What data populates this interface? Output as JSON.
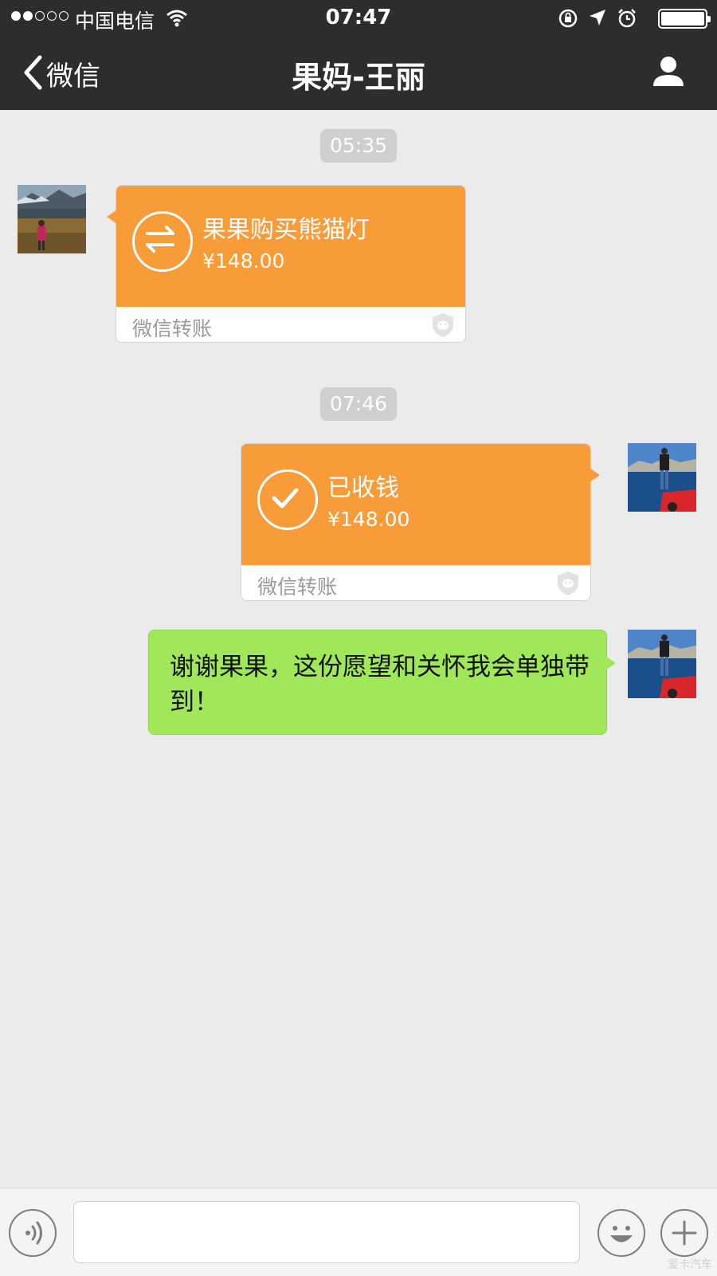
{
  "status_bar": {
    "carrier": "中国电信",
    "time": "07:47"
  },
  "nav": {
    "back_label": "微信",
    "title": "果妈-王丽"
  },
  "messages": [
    {
      "type": "timestamp",
      "text": "05:35"
    },
    {
      "type": "transfer",
      "direction": "incoming",
      "title": "果果购买熊猫灯",
      "amount": "¥148.00",
      "label": "微信转账",
      "icon": "transfer-arrows-icon"
    },
    {
      "type": "timestamp",
      "text": "07:46"
    },
    {
      "type": "transfer",
      "direction": "outgoing",
      "title": "已收钱",
      "amount": "¥148.00",
      "label": "微信转账",
      "icon": "checkmark-icon"
    },
    {
      "type": "text",
      "direction": "outgoing",
      "text": "谢谢果果，这份愿望和关怀我会单独带到！"
    }
  ],
  "input": {
    "value": "",
    "placeholder": ""
  },
  "colors": {
    "bar_bg": "#2d2d2f",
    "chat_bg": "#ebebeb",
    "transfer_orange": "#f89c3a",
    "outgoing_green": "#a0e75a"
  },
  "watermark": "爱卡汽车"
}
